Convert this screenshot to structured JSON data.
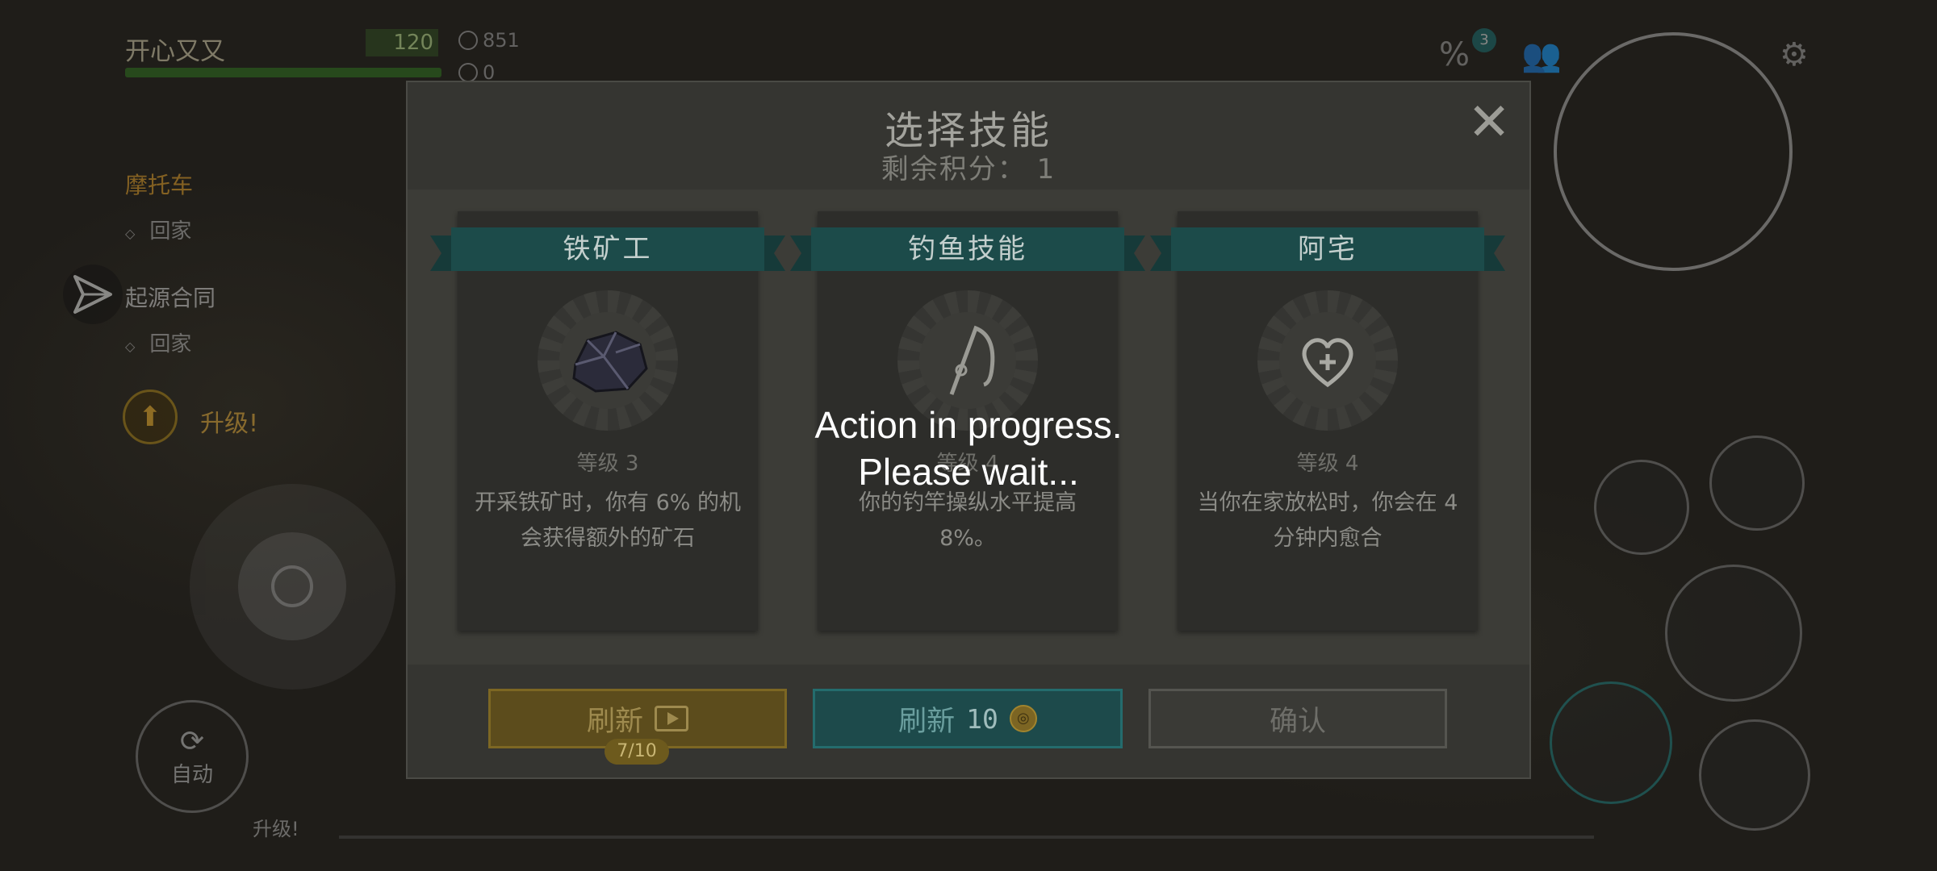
{
  "hud": {
    "player_name": "开心又又",
    "level": "120",
    "stat_1": "851",
    "stat_2": "0",
    "quests": [
      {
        "title": "摩托车",
        "item": "回家",
        "color": "#d89a2a"
      },
      {
        "title": "起源合同",
        "item": "回家",
        "color": "#c8c8c8"
      }
    ],
    "upgrade_label": "升级!",
    "auto_label": "自动",
    "xp_label": "升级!",
    "discount_badge": "3"
  },
  "dialog": {
    "title": "选择技能",
    "remaining": "剩余积分： 1",
    "close_symbol": "✕",
    "cards": [
      {
        "name": "铁矿工",
        "level": "等级 3",
        "desc": "开采铁矿时，你有 6% 的机会获得额外的矿石",
        "icon": "ore-icon"
      },
      {
        "name": "钓鱼技能",
        "level": "等级 4",
        "desc": "你的钓竿操纵水平提高 8%。",
        "icon": "fishing-rod-icon"
      },
      {
        "name": "阿宅",
        "level": "等级 4",
        "desc": "当你在家放松时，你会在 4分钟内愈合",
        "icon": "heart-plus-icon"
      }
    ],
    "buttons": {
      "refresh_ad": "刷新",
      "refresh_ad_counter": "7/10",
      "refresh_coin": "刷新",
      "refresh_coin_cost": "10",
      "confirm": "确认"
    }
  },
  "overlay": {
    "line1": "Action in progress.",
    "line2": "Please wait..."
  }
}
